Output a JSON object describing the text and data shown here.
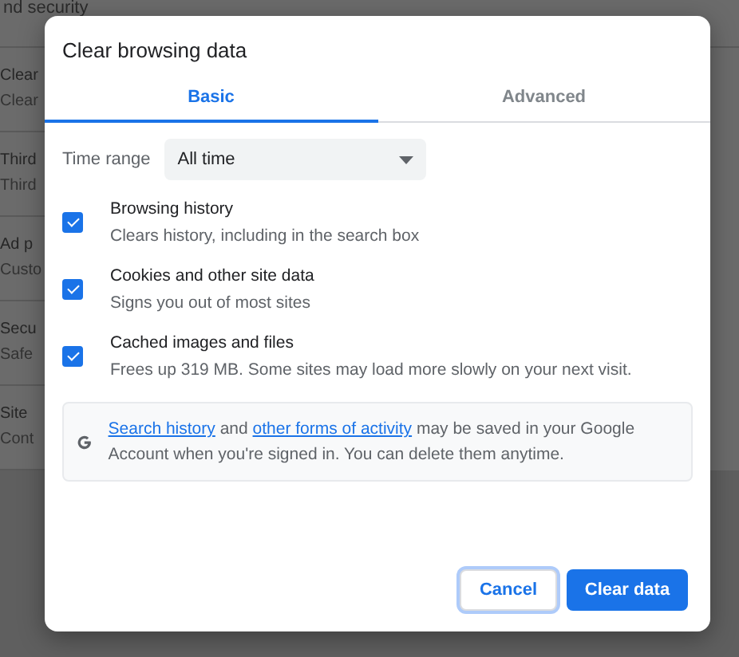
{
  "background_page": {
    "heading": "nd security",
    "rows": [
      {
        "title": "Clear",
        "subtitle": "Clear"
      },
      {
        "title": "Third",
        "subtitle": "Third"
      },
      {
        "title": "Ad p",
        "subtitle": "Custo"
      },
      {
        "title": "Secu",
        "subtitle": "Safe"
      },
      {
        "title": "Site",
        "subtitle": "Cont"
      }
    ]
  },
  "dialog": {
    "title": "Clear browsing data",
    "tabs": [
      {
        "label": "Basic",
        "selected": true
      },
      {
        "label": "Advanced",
        "selected": false
      }
    ],
    "time_range": {
      "label": "Time range",
      "value": "All time"
    },
    "options": [
      {
        "title": "Browsing history",
        "description": "Clears history, including in the search box",
        "checked": true
      },
      {
        "title": "Cookies and other site data",
        "description": "Signs you out of most sites",
        "checked": true
      },
      {
        "title": "Cached images and files",
        "description": "Frees up 319 MB. Some sites may load more slowly on your next visit.",
        "checked": true
      }
    ],
    "notice": {
      "segments": [
        {
          "kind": "link",
          "text": "Search history"
        },
        {
          "kind": "plain",
          "text": " and "
        },
        {
          "kind": "link",
          "text": "other forms of activity"
        },
        {
          "kind": "plain",
          "text": " may be saved in your Google Account when you're signed in. You can delete them anytime."
        }
      ]
    },
    "buttons": [
      {
        "kind": "secondary",
        "label": "Cancel"
      },
      {
        "kind": "primary",
        "label": "Clear data"
      }
    ]
  }
}
